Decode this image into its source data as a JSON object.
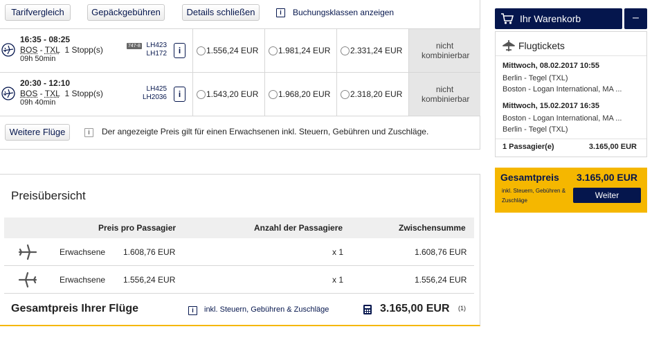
{
  "toolbar": {
    "fare_compare": "Tarifvergleich",
    "baggage_fees": "Gepäckgebühren",
    "close_details": "Details schließen",
    "booking_classes": "Buchungsklassen anzeigen",
    "info_glyph": "i"
  },
  "flights": [
    {
      "times": "16:35 - 08:25",
      "origin": "BOS",
      "destination": "TXL",
      "stops": "1 Stopp(s)",
      "duration": "09h 50min",
      "aircraft": "747-8",
      "flight_numbers": [
        "LH423",
        "LH172"
      ],
      "fares": [
        "1.556,24 EUR",
        "1.981,24 EUR",
        "2.331,24 EUR"
      ],
      "unavailable": "nicht kombinierbar"
    },
    {
      "times": "20:30 - 12:10",
      "origin": "BOS",
      "destination": "TXL",
      "stops": "1 Stopp(s)",
      "duration": "09h 40min",
      "aircraft": "",
      "flight_numbers": [
        "LH425",
        "LH2036"
      ],
      "fares": [
        "1.543,20 EUR",
        "1.968,20 EUR",
        "2.318,20 EUR"
      ],
      "unavailable": "nicht kombinierbar"
    }
  ],
  "more_flights": "Weitere Flüge",
  "price_note": "Der angezeigte Preis gilt für einen Erwachsenen inkl. Steuern, Gebühren und Zuschläge.",
  "overview": {
    "heading": "Preisübersicht",
    "col_price": "Preis pro Passagier",
    "col_count": "Anzahl der Passagiere",
    "col_subtotal": "Zwischensumme",
    "rows": [
      {
        "type": "Erwachsene",
        "price": "1.608,76 EUR",
        "count": "x 1",
        "subtotal": "1.608,76 EUR"
      },
      {
        "type": "Erwachsene",
        "price": "1.556,24 EUR",
        "count": "x 1",
        "subtotal": "1.556,24 EUR"
      }
    ],
    "total_label": "Gesamtpreis Ihrer Flüge",
    "total_note": "inkl. Steuern, Gebühren & Zuschläge",
    "total_value": "3.165,00 EUR",
    "footnote": "(1)"
  },
  "cart": {
    "button": "Ihr Warenkorb",
    "collapse": "–",
    "title": "Flugtickets",
    "legs": [
      {
        "date": "Mittwoch, 08.02.2017 10:55",
        "from": "Berlin - Tegel (TXL)",
        "to": "Boston - Logan International, MA ..."
      },
      {
        "date": "Mittwoch, 15.02.2017 16:35",
        "from": "Boston - Logan International, MA ...",
        "to": "Berlin - Tegel (TXL)"
      }
    ],
    "passengers": "1 Passagier(e)",
    "passengers_price": "3.165,00 EUR"
  },
  "total_box": {
    "label": "Gesamtpreis",
    "value": "3.165,00 EUR",
    "note": "inkl. Steuern, Gebühren & Zuschläge",
    "next": "Weiter"
  },
  "colors": {
    "brand": "#05164d",
    "accent": "#f5b700",
    "unavailable_bg": "#e6e6e6"
  },
  "icons": [
    "plane-icon",
    "cart-icon",
    "info-icon",
    "calculator-icon"
  ]
}
